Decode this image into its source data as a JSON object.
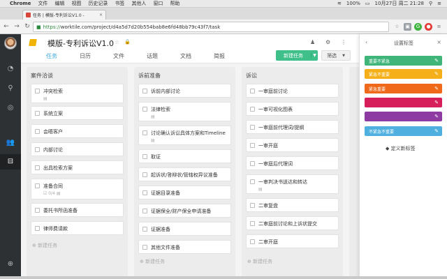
{
  "menubar": {
    "app": "Chrome",
    "items": [
      "文件",
      "编辑",
      "视图",
      "历史记录",
      "书签",
      "其他人",
      "窗口",
      "帮助"
    ],
    "battery": "100%",
    "datetime": "10月27日 周二  21:28"
  },
  "browser": {
    "tab_title": "任务 | 模版-专利诉讼V1.0 -",
    "url_scheme": "https://",
    "url_rest": "worktile.com/project/d4a5d7d20b554bab8e6fd48bb79c43f7/task"
  },
  "project": {
    "title": "模版-专利诉讼V1.0",
    "nav_tabs": [
      "任务",
      "日历",
      "文件",
      "话题",
      "文档",
      "简报"
    ],
    "active_tab": "任务",
    "new_task_label": "新建任务",
    "filter_label": "筛选"
  },
  "board": {
    "columns": [
      {
        "title": "案件洽谈",
        "cards": [
          {
            "text": "冲突检索",
            "meta": "▤"
          },
          {
            "text": "系统立案"
          },
          {
            "text": "会晤客户"
          },
          {
            "text": "内部讨论"
          },
          {
            "text": "出具检索方案"
          },
          {
            "text": "准备合同",
            "meta": "☑ 0/4  ▤"
          },
          {
            "text": "委托书所函准备"
          },
          {
            "text": "律师费请款"
          }
        ],
        "add_label": "⊕ 新建任务"
      },
      {
        "title": "诉前准备",
        "cards": [
          {
            "text": "诉前内部讨论"
          },
          {
            "text": "法律检索",
            "meta": "▤"
          },
          {
            "text": "讨论确认诉讼具体方案和Timeline",
            "meta": "▤"
          },
          {
            "text": "取证"
          },
          {
            "text": "起诉状/答辩状/管辖权异议准备"
          },
          {
            "text": "证据目录准备"
          },
          {
            "text": "证据保全/财产保全申请准备"
          },
          {
            "text": "证据准备"
          },
          {
            "text": "其他文件准备"
          }
        ],
        "add_label": "⊕ 新建任务"
      },
      {
        "title": "诉讼",
        "cards": [
          {
            "text": "一审庭前讨论"
          },
          {
            "text": "一审可视化图表"
          },
          {
            "text": "一审庭前代理词/提纲"
          },
          {
            "text": "一审开庭"
          },
          {
            "text": "一审庭后代理词"
          },
          {
            "text": "一审判决书送达和转达",
            "meta": "▤"
          },
          {
            "text": "二审复盘"
          },
          {
            "text": "二审庭前讨论和上诉状提交"
          },
          {
            "text": "二审开庭"
          }
        ],
        "add_label": "⊕ 新建任务"
      }
    ]
  },
  "tag_panel": {
    "title": "设置标签",
    "tags": [
      {
        "label": "重要不紧急",
        "color": "#3fb57a"
      },
      {
        "label": "紧急不重要",
        "color": "#f5b019"
      },
      {
        "label": "紧急重要",
        "color": "#f0691a"
      },
      {
        "label": "",
        "color": "#d61f5a"
      },
      {
        "label": "",
        "color": "#8e3aa3"
      },
      {
        "label": "不紧急不重要",
        "color": "#4fb0e0"
      }
    ],
    "define_label": "定义新标签"
  },
  "icons": {
    "back": "chevron-left-icon",
    "close": "close-icon",
    "pen": "pencil-icon",
    "tag": "tag-icon"
  }
}
